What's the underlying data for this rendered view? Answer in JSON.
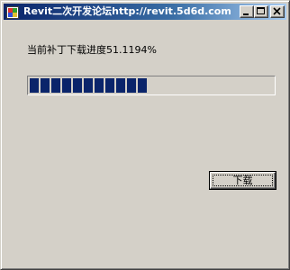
{
  "window": {
    "title": "Revit二次开发论坛http://revit.5d6d.com",
    "app_icon": "app-icon",
    "minimize_icon": "minimize-icon",
    "maximize_icon": "maximize-icon",
    "close_icon": "close-icon"
  },
  "progress": {
    "label": "当前补丁下载进度51.1194%",
    "percent": 51.1194,
    "fill_color": "#0a246a"
  },
  "buttons": {
    "download_label": "下载"
  },
  "colors": {
    "face": "#d4d0c8",
    "title_start": "#0a246a",
    "title_end": "#a6caf0"
  }
}
